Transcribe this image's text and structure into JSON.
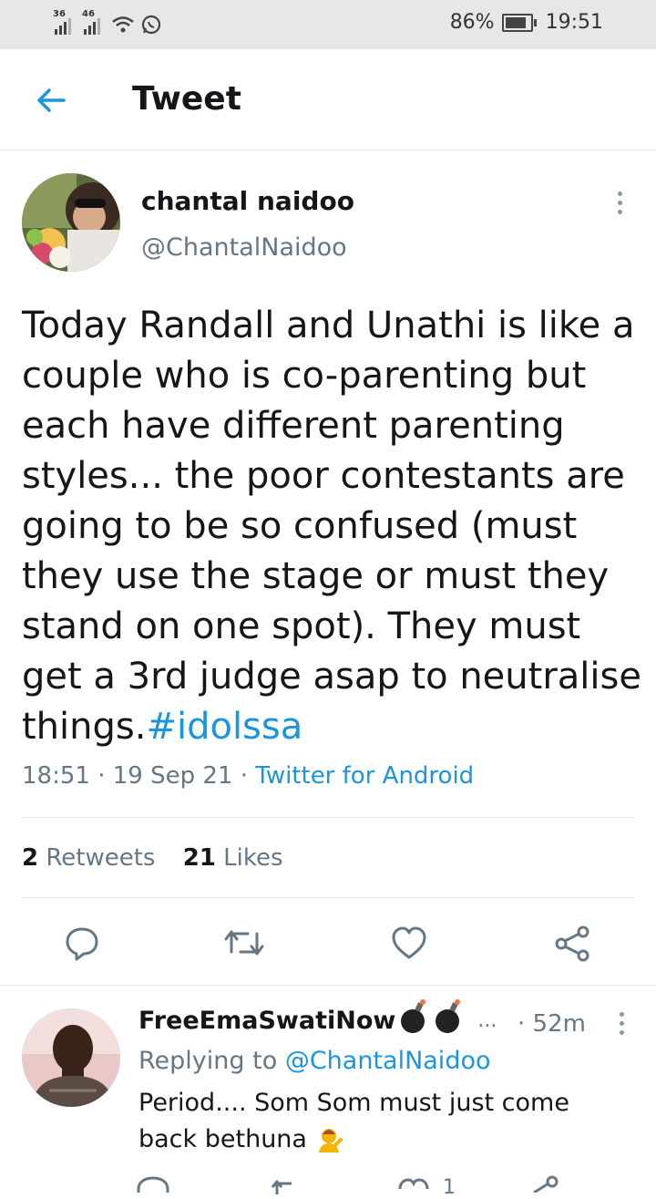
{
  "status_bar": {
    "signal1_label": "36",
    "signal2_label": "46",
    "battery_percent": "86%",
    "battery_level": 0.86,
    "time": "19:51"
  },
  "header": {
    "title": "Tweet"
  },
  "tweet": {
    "author_name": "chantal naidoo",
    "author_handle": "@ChantalNaidoo",
    "text": "Today Randall and Unathi is like a couple who is co-parenting but each have different parenting styles... the poor contestants are going to be so confused (must they use the stage or must they stand on one spot). They must get a 3rd judge asap to neutralise things.",
    "hashtag": "#idolssa",
    "time": "18:51",
    "date": "19 Sep 21",
    "source": "Twitter for Android",
    "separator": "·",
    "retweets_count": "2",
    "retweets_label": "Retweets",
    "likes_count": "21",
    "likes_label": "Likes"
  },
  "reply": {
    "author_name": "FreeEmaSwatiNow",
    "ellipsis": "...",
    "time": "· 52m",
    "replying_prefix": "Replying to",
    "replying_handle": "@ChantalNaidoo",
    "text": "Period.... Som Som must just come back bethuna",
    "like_count": "1"
  },
  "icons": {
    "back": "back-arrow-icon",
    "more": "more-vertical-icon",
    "reply": "reply-icon",
    "retweet": "retweet-icon",
    "like": "heart-icon",
    "share": "share-icon"
  },
  "colors": {
    "accent": "#1b95e0",
    "secondary_text": "#657786",
    "primary_text": "#14171a",
    "status_bar_bg": "#e7e7e7"
  }
}
